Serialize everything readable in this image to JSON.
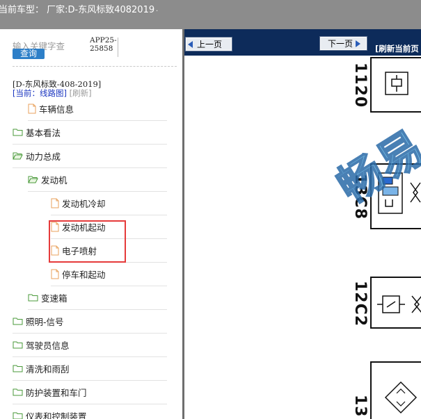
{
  "titlebar": {
    "title": "当前车型：  厂家:D-东风标致4082019",
    "dot": "."
  },
  "left_panel": {
    "search_placeholder": "输入关键字查",
    "search_button": "查询",
    "app_code": "APP25-25858",
    "model": "[D-东风标致-408-2019]",
    "current_label": "[当前：线路图]",
    "refresh_label": "[刷新]",
    "tree": [
      {
        "label": "车辆信息",
        "icon": "document-icon"
      },
      {
        "label": "基本看法",
        "icon": "folder-icon"
      },
      {
        "label": "动力总成",
        "icon": "folder-open-icon"
      },
      {
        "label": "发动机",
        "icon": "folder-open-icon"
      },
      {
        "label": "发动机冷却",
        "icon": "document-icon"
      },
      {
        "label": "发动机起动",
        "icon": "document-icon"
      },
      {
        "label": "电子喷射",
        "icon": "document-icon"
      },
      {
        "label": "停车和起动",
        "icon": "document-icon"
      },
      {
        "label": "变速箱",
        "icon": "folder-icon"
      },
      {
        "label": "照明-信号",
        "icon": "folder-icon"
      },
      {
        "label": "驾驶员信息",
        "icon": "folder-icon"
      },
      {
        "label": "清洗和雨刮",
        "icon": "folder-icon"
      },
      {
        "label": "防护装置和车门",
        "icon": "folder-icon"
      },
      {
        "label": "仪表和控制装置",
        "icon": "folder-icon"
      }
    ]
  },
  "right_panel": {
    "prev_button": "上一页",
    "next_button": "下一页",
    "refresh_page": "[刷新当前页",
    "diagram_codes": [
      "1120",
      "13C8",
      "12C2",
      "13"
    ],
    "watermark": "畅易"
  },
  "colors": {
    "titlebar_bg": "#8c8c8c",
    "nav_bg": "#0d2b5a",
    "search_button_bg": "#2d7fc8",
    "highlight": "#e53a3a",
    "watermark": "#5fb8e8"
  }
}
